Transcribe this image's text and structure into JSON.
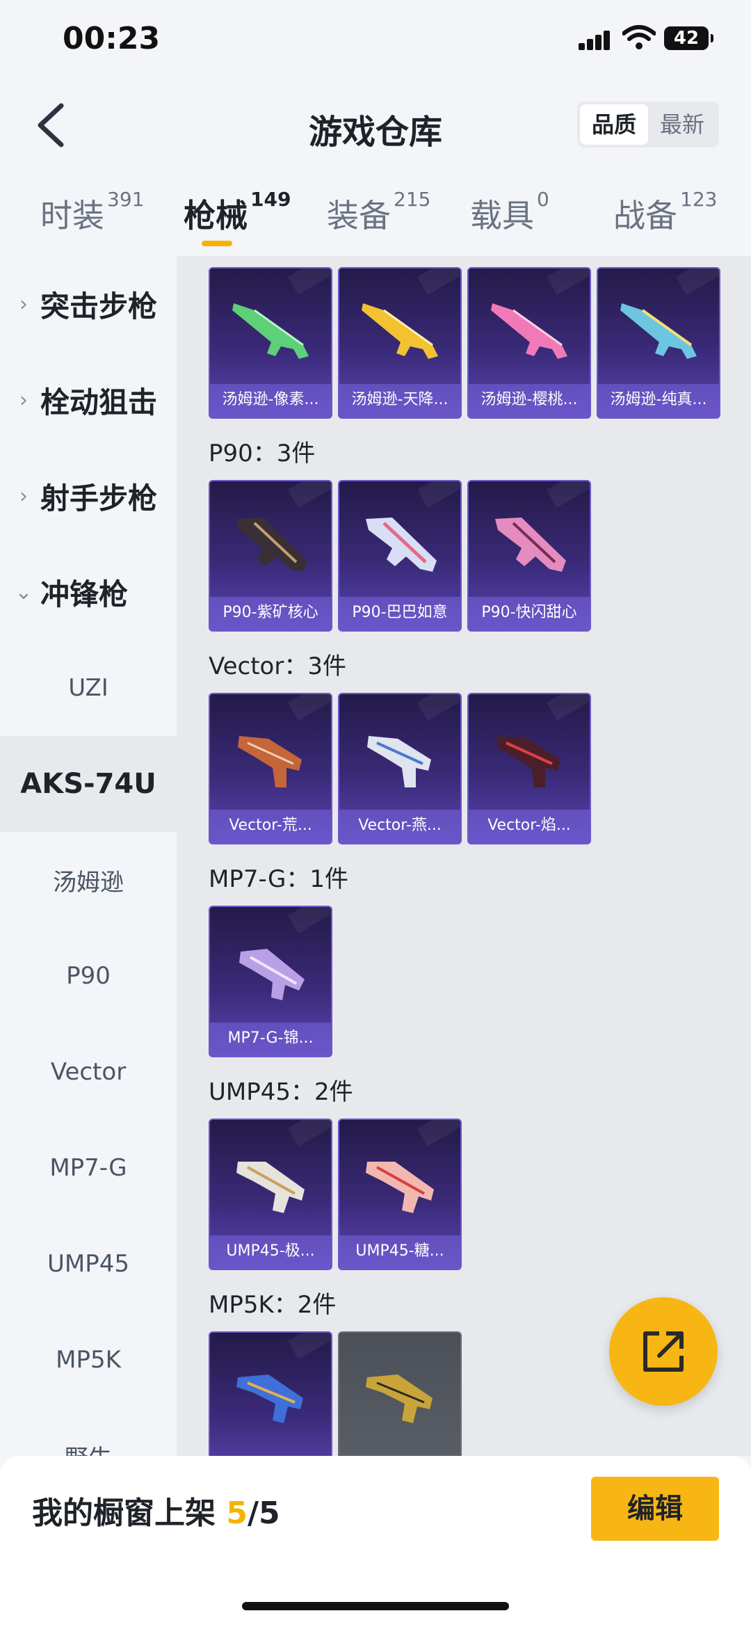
{
  "status": {
    "time": "00:23",
    "battery": "42"
  },
  "header": {
    "title": "游戏仓库",
    "sort_options": [
      "品质",
      "最新"
    ]
  },
  "tabs": [
    {
      "label": "时装",
      "count": "391"
    },
    {
      "label": "枪械",
      "count": "149"
    },
    {
      "label": "装备",
      "count": "215"
    },
    {
      "label": "载具",
      "count": "0"
    },
    {
      "label": "战备",
      "count": "123"
    }
  ],
  "sidebar": {
    "categories": [
      {
        "label": "突击步枪",
        "chevron": "›"
      },
      {
        "label": "栓动狙击",
        "chevron": "›"
      },
      {
        "label": "射手步枪",
        "chevron": "›"
      },
      {
        "label": "冲锋枪",
        "chevron": "⌄"
      }
    ],
    "sub_items": [
      "UZI",
      "AKS-74U",
      "汤姆逊",
      "P90",
      "Vector",
      "MP7-G",
      "UMP45",
      "MP5K",
      "野牛"
    ]
  },
  "sections": {
    "thompson": {
      "items": [
        "汤姆逊-像素...",
        "汤姆逊-天降...",
        "汤姆逊-樱桃...",
        "汤姆逊-纯真..."
      ]
    },
    "p90": {
      "title": "P90：3件",
      "items": [
        "P90-紫矿核心",
        "P90-巴巴如意",
        "P90-快闪甜心"
      ]
    },
    "vector": {
      "title": "Vector：3件",
      "items": [
        "Vector-荒...",
        "Vector-燕...",
        "Vector-焰..."
      ]
    },
    "mp7": {
      "title": "MP7-G：1件",
      "items": [
        "MP7-G-锦..."
      ]
    },
    "ump45": {
      "title": "UMP45：2件",
      "items": [
        "UMP45-极...",
        "UMP45-糖..."
      ]
    },
    "mp5k": {
      "title": "MP5K：2件"
    }
  },
  "bottom": {
    "label": "我的橱窗上架 ",
    "count": "5",
    "total": "/5",
    "edit": "编辑"
  },
  "colors": {
    "accent": "#f7b613",
    "card_purple": "#3a2a78",
    "card_gray": "#5c6068"
  },
  "icons": [
    "back-arrow-icon",
    "share-icon",
    "chevron-right-icon",
    "chevron-down-icon",
    "wifi-icon",
    "signal-icon",
    "battery-icon"
  ]
}
